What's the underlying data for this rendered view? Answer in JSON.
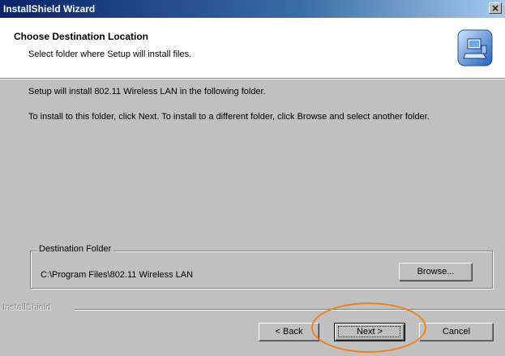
{
  "window": {
    "title": "InstallShield Wizard",
    "close_label": "×"
  },
  "header": {
    "title": "Choose Destination Location",
    "subtitle": "Select folder where Setup will install files."
  },
  "body": {
    "line1": "Setup will install 802.11 Wireless LAN in the following folder.",
    "line2": "To install to this folder, click Next. To install to a different folder, click Browse and select another folder."
  },
  "destination": {
    "group_label": "Destination Folder",
    "path": "C:\\Program Files\\802.11 Wireless LAN",
    "browse_label": "Browse..."
  },
  "footer": {
    "brand": "InstallShield",
    "back_label": "< Back",
    "next_label": "Next >",
    "cancel_label": "Cancel"
  },
  "colors": {
    "title_bar": "#0a246a",
    "dialog_bg": "#c0c0c0",
    "header_bg": "#ffffff",
    "annotation": "#f07f1a"
  },
  "icons": {
    "header": "computer-install-icon",
    "close": "close-icon"
  }
}
